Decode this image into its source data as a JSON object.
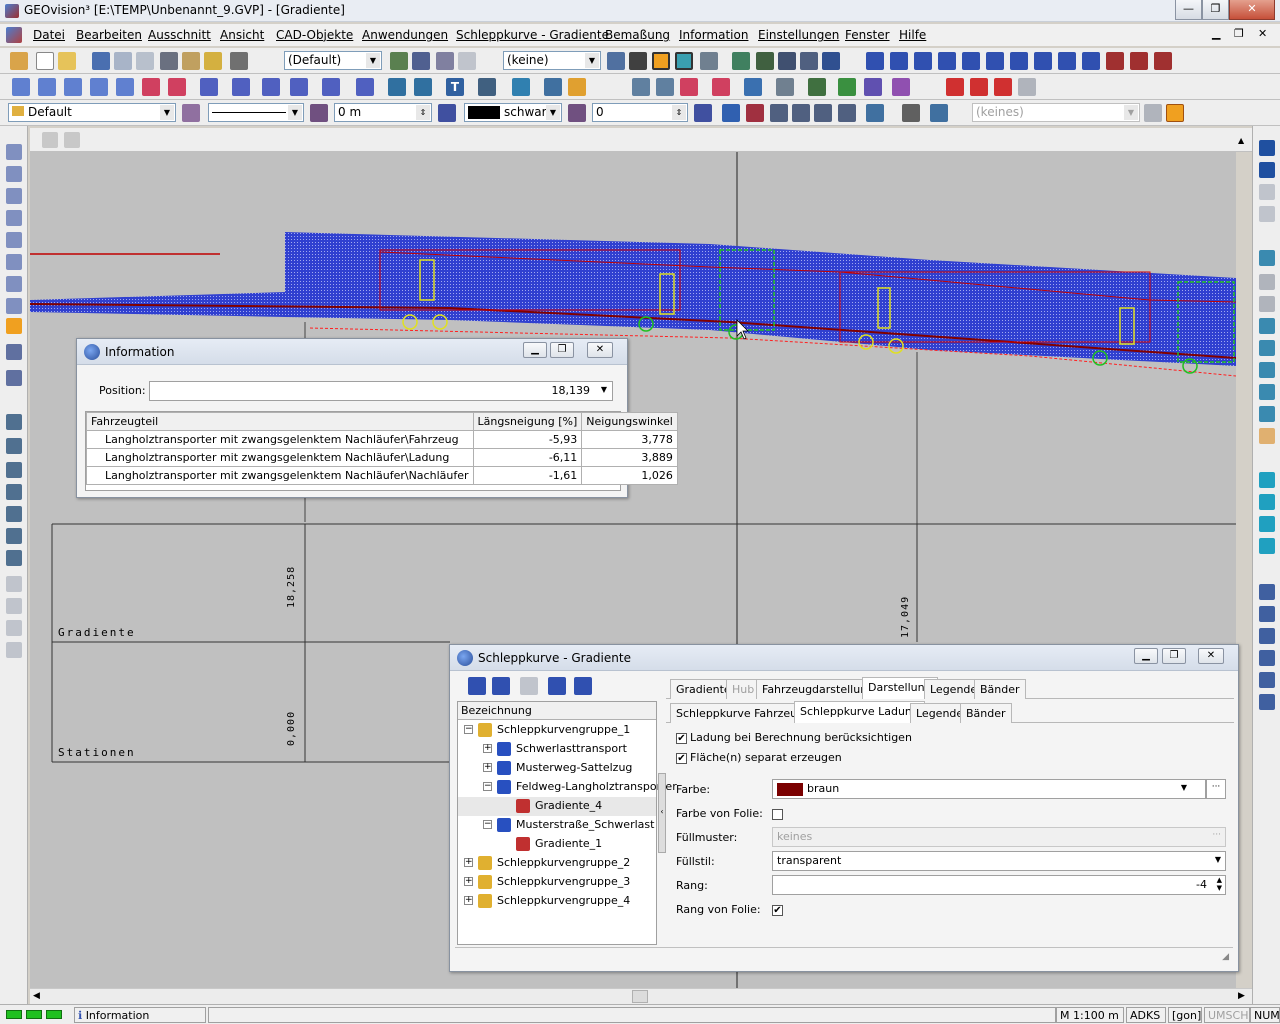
{
  "window": {
    "title": "GEOvision³  [E:\\TEMP\\Unbenannt_9.GVP] - [Gradiente]",
    "minimize": "—",
    "maximize": "❐",
    "close": "✕"
  },
  "menu": [
    "Datei",
    "Bearbeiten",
    "Ausschnitt",
    "Ansicht",
    "CAD-Objekte",
    "Anwendungen",
    "Schleppkurve - Gradiente",
    "Bemaßung",
    "Information",
    "Einstellungen",
    "Fenster",
    "Hilfe"
  ],
  "toolbar1": {
    "layer_dropdown": "(Default)",
    "object_dropdown": "(keine)"
  },
  "toolbar3": {
    "style_dropdown": "Default",
    "width_value": "0 m",
    "color_label": "schwarz",
    "angle_value": "0",
    "layer_right": "(keines)"
  },
  "drawing": {
    "label_gradiente": "Gradiente",
    "label_stationen": "Stationen",
    "value_left": "18,258",
    "value_right": "17,049",
    "value_station": "0,000"
  },
  "info_dialog": {
    "title": "Information",
    "position_label": "Position:",
    "position_value": "18,139",
    "columns": [
      "Fahrzeugteil",
      "Längsneigung [%]",
      "Neigungswinkel"
    ],
    "rows": [
      {
        "part": "Langholztransporter mit zwangsgelenktem Nachläufer\\Fahrzeug",
        "slope": "-5,93",
        "angle": "3,778"
      },
      {
        "part": "Langholztransporter mit zwangsgelenktem Nachläufer\\Ladung",
        "slope": "-6,11",
        "angle": "3,889"
      },
      {
        "part": "Langholztransporter mit zwangsgelenktem Nachläufer\\Nachläufer",
        "slope": "-1,61",
        "angle": "1,026"
      }
    ]
  },
  "sk_dialog": {
    "title": "Schleppkurve - Gradiente",
    "tree_header": "Bezeichnung",
    "tree": [
      {
        "label": "Schleppkurvengruppe_1",
        "level": 0,
        "pm": "−"
      },
      {
        "label": "Schwerlasttransport",
        "level": 1,
        "pm": "+"
      },
      {
        "label": "Musterweg-Sattelzug",
        "level": 1,
        "pm": "+"
      },
      {
        "label": "Feldweg-Langholztransporter",
        "level": 1,
        "pm": "−"
      },
      {
        "label": "Gradiente_4",
        "level": 2,
        "pm": ""
      },
      {
        "label": "Musterstraße_Schwerlast",
        "level": 1,
        "pm": "−"
      },
      {
        "label": "Gradiente_1",
        "level": 2,
        "pm": ""
      },
      {
        "label": "Schleppkurvengruppe_2",
        "level": 0,
        "pm": "+"
      },
      {
        "label": "Schleppkurvengruppe_3",
        "level": 0,
        "pm": "+"
      },
      {
        "label": "Schleppkurvengruppe_4",
        "level": 0,
        "pm": "+"
      }
    ],
    "tabs_main": [
      "Gradiente",
      "Hub",
      "Fahrzeugdarstellung",
      "Darstellung",
      "Legende",
      "Bänder"
    ],
    "tabs_sub": [
      "Schleppkurve Fahrzeug",
      "Schleppkurve Ladung",
      "Legende",
      "Bänder"
    ],
    "check_ladung": "Ladung bei Berechnung berücksichtigen",
    "check_flaeche": "Fläche(n) separat erzeugen",
    "farbe_label": "Farbe:",
    "farbe_value": "braun",
    "farbe_folie_label": "Farbe von Folie:",
    "fuellmuster_label": "Füllmuster:",
    "fuellmuster_value": "keines",
    "fuellstil_label": "Füllstil:",
    "fuellstil_value": "transparent",
    "rang_label": "Rang:",
    "rang_value": "-4",
    "rang_folie_label": "Rang von Folie:",
    "check_mark": "✔",
    "ellipsis": "···",
    "colors": {
      "farbe_swatch": "#7a0000"
    }
  },
  "status": {
    "text": "Information Gradiente:",
    "scale": "M 1:100  m",
    "adks": "ADKS",
    "gon": "[gon]",
    "umsch": "UMSCH",
    "num": "NUM"
  }
}
